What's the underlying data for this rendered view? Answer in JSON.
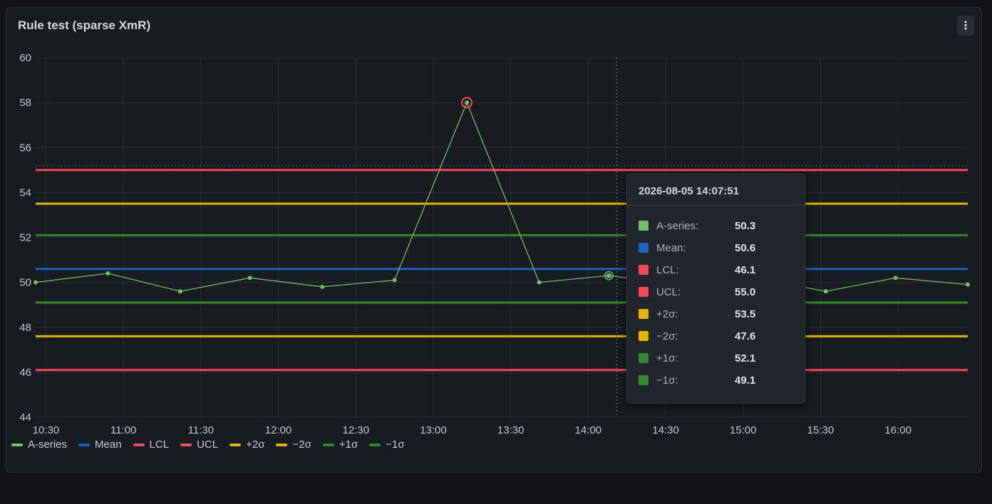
{
  "panel": {
    "title": "Rule test (sparse XmR)",
    "menu_icon": "⋮"
  },
  "chart_data": {
    "type": "line",
    "title": "Rule test (sparse XmR)",
    "ylim": [
      44,
      60
    ],
    "yticks": [
      60,
      58,
      56,
      54,
      52,
      50,
      48,
      46,
      44
    ],
    "xticks": [
      "10:30",
      "11:00",
      "11:30",
      "12:00",
      "12:30",
      "13:00",
      "13:30",
      "14:00",
      "14:30",
      "15:00",
      "15:30",
      "16:00"
    ],
    "xlim": [
      "10:26",
      "16:27"
    ],
    "grid": true,
    "legend_position": "bottom-left",
    "series": [
      {
        "name": "A-series",
        "color": "#73bf69",
        "points": [
          {
            "x": "10:26",
            "y": 50.0
          },
          {
            "x": "10:54",
            "y": 50.4
          },
          {
            "x": "11:22",
            "y": 49.6
          },
          {
            "x": "11:49",
            "y": 50.2
          },
          {
            "x": "12:17",
            "y": 49.8
          },
          {
            "x": "12:45",
            "y": 50.1
          },
          {
            "x": "13:13",
            "y": 58.0
          },
          {
            "x": "13:41",
            "y": 50.0
          },
          {
            "x": "14:08",
            "y": 50.3
          },
          {
            "x": "14:36",
            "y": 49.9
          },
          {
            "x": "15:04",
            "y": 50.2
          },
          {
            "x": "15:32",
            "y": 49.6
          },
          {
            "x": "15:59",
            "y": 50.2
          },
          {
            "x": "16:27",
            "y": 49.9
          }
        ],
        "violations": [
          {
            "x": "13:13",
            "y": 58.0
          }
        ]
      },
      {
        "name": "Mean",
        "color": "#1f60c4",
        "value": 50.6
      },
      {
        "name": "LCL",
        "color": "#f2495c",
        "value": 46.1
      },
      {
        "name": "UCL",
        "color": "#f2495c",
        "value": 55.0
      },
      {
        "name": "+2σ",
        "color": "#e0b400",
        "value": 53.5
      },
      {
        "name": "−2σ",
        "color": "#e0b400",
        "value": 47.6
      },
      {
        "name": "+1σ",
        "color": "#37872d",
        "value": 52.1
      },
      {
        "name": "−1σ",
        "color": "#37872d",
        "value": 49.1
      }
    ],
    "hover_time": "14:11"
  },
  "legend": [
    {
      "label": "A-series",
      "color": "#73bf69"
    },
    {
      "label": "Mean",
      "color": "#1f60c4"
    },
    {
      "label": "LCL",
      "color": "#f2495c"
    },
    {
      "label": "UCL",
      "color": "#f2495c"
    },
    {
      "label": "+2σ",
      "color": "#e0b400"
    },
    {
      "label": "−2σ",
      "color": "#e0b400"
    },
    {
      "label": "+1σ",
      "color": "#37872d"
    },
    {
      "label": "−1σ",
      "color": "#37872d"
    }
  ],
  "tooltip": {
    "time": "2026-08-05 14:07:51",
    "rows": [
      {
        "label": "A-series:",
        "value": "50.3",
        "color": "#73bf69"
      },
      {
        "label": "Mean:",
        "value": "50.6",
        "color": "#1f60c4"
      },
      {
        "label": "LCL:",
        "value": "46.1",
        "color": "#f2495c"
      },
      {
        "label": "UCL:",
        "value": "55.0",
        "color": "#f2495c"
      },
      {
        "label": "+2σ:",
        "value": "53.5",
        "color": "#e0b400"
      },
      {
        "label": "−2σ:",
        "value": "47.6",
        "color": "#e0b400"
      },
      {
        "label": "+1σ:",
        "value": "52.1",
        "color": "#37872d"
      },
      {
        "label": "−1σ:",
        "value": "49.1",
        "color": "#37872d"
      }
    ]
  }
}
